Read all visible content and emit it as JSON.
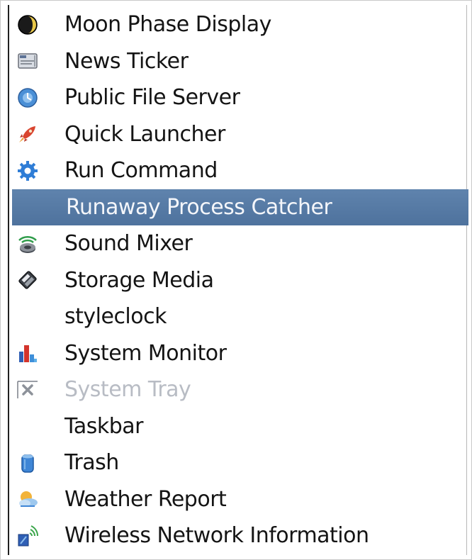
{
  "menu": {
    "selected_index": 5,
    "items": [
      {
        "label": "Moon Phase Display",
        "icon": "moon-phase-icon"
      },
      {
        "label": "News Ticker",
        "icon": "news-ticker-icon"
      },
      {
        "label": "Public File Server",
        "icon": "file-server-icon"
      },
      {
        "label": "Quick Launcher",
        "icon": "rocket-icon"
      },
      {
        "label": "Run Command",
        "icon": "gear-icon"
      },
      {
        "label": "Runaway Process Catcher",
        "icon": ""
      },
      {
        "label": "Sound Mixer",
        "icon": "speaker-icon"
      },
      {
        "label": "Storage Media",
        "icon": "disk-icon"
      },
      {
        "label": "styleclock",
        "icon": ""
      },
      {
        "label": "System Monitor",
        "icon": "bar-chart-icon"
      },
      {
        "label": "System Tray",
        "icon": "close-icon",
        "disabled": true
      },
      {
        "label": "Taskbar",
        "icon": ""
      },
      {
        "label": "Trash",
        "icon": "trash-icon"
      },
      {
        "label": "Weather Report",
        "icon": "weather-icon"
      },
      {
        "label": "Wireless Network Information",
        "icon": "wireless-icon"
      }
    ]
  },
  "colors": {
    "selection": "#5a7ea9",
    "selected_text": "#f4f6fa",
    "text": "#141414",
    "disabled_text": "#b8bcc4"
  }
}
